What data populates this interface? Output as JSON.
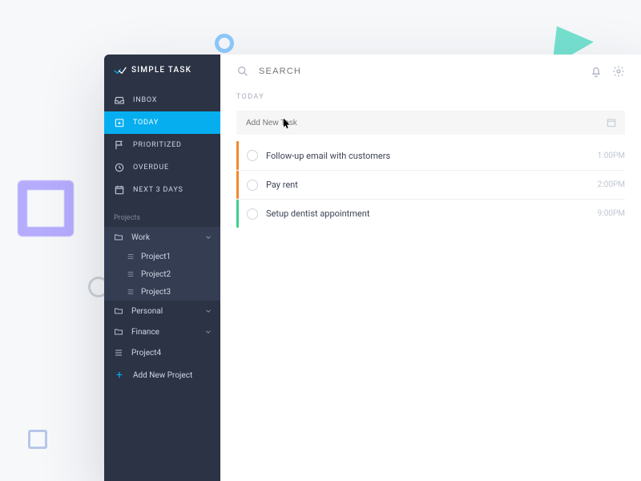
{
  "app": {
    "name": "SIMPLE TASK"
  },
  "search": {
    "placeholder": "SEARCH"
  },
  "nav": {
    "inbox": "INBOX",
    "today": "TODAY",
    "prioritized": "PRIORITIZED",
    "overdue": "OVERDUE",
    "next3days": "NEXT 3 DAYS"
  },
  "projects": {
    "sectionLabel": "Projects",
    "work": {
      "label": "Work",
      "children": [
        "Project1",
        "Project2",
        "Project3"
      ]
    },
    "personal": {
      "label": "Personal"
    },
    "finance": {
      "label": "Finance"
    },
    "loose": "Project4",
    "addNew": "Add New Project"
  },
  "main": {
    "heading": "TODAY",
    "addTaskPlaceholder": "Add New Task",
    "tasks": [
      {
        "title": "Follow-up email with customers",
        "time": "1:00PM",
        "accent": "#f28a2e"
      },
      {
        "title": "Pay rent",
        "time": "2:00PM",
        "accent": "#f28a2e"
      },
      {
        "title": "Setup dentist appointment",
        "time": "9:00PM",
        "accent": "#3fcf8e"
      }
    ]
  }
}
